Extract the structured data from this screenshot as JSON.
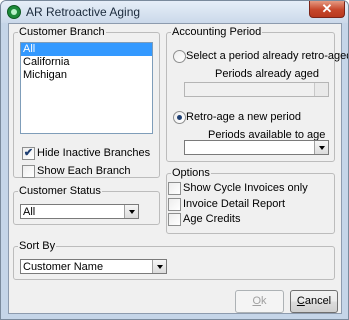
{
  "window": {
    "title": "AR Retroactive Aging",
    "close_glyph": "✕"
  },
  "customer_branch": {
    "legend": "Customer Branch",
    "items": [
      "All",
      "California",
      "Michigan"
    ],
    "hide_inactive_label": "Hide Inactive Branches",
    "hide_inactive_checked": true,
    "show_each_label": "Show Each Branch",
    "show_each_checked": false
  },
  "customer_status": {
    "legend": "Customer Status",
    "value": "All"
  },
  "accounting_period": {
    "legend": "Accounting Period",
    "option_existing_label": "Select a period already retro-aged",
    "periods_aged_label": "Periods already aged",
    "periods_aged_value": "",
    "option_new_label": "Retro-age a new period",
    "selected_option": "new",
    "periods_available_label": "Periods available to age",
    "periods_available_value": ""
  },
  "options": {
    "legend": "Options",
    "items": [
      {
        "label": "Show Cycle Invoices only",
        "checked": false
      },
      {
        "label": "Invoice Detail Report",
        "checked": false
      },
      {
        "label": "Age Credits",
        "checked": false
      }
    ]
  },
  "sort_by": {
    "legend": "Sort By",
    "value": "Customer Name"
  },
  "buttons": {
    "ok_first": "O",
    "ok_rest": "k",
    "ok_enabled": false,
    "cancel_first": "C",
    "cancel_rest": "ancel",
    "cancel_enabled": true
  },
  "icons": {
    "app": "green-circle-app-icon",
    "checkmark": "✔"
  }
}
